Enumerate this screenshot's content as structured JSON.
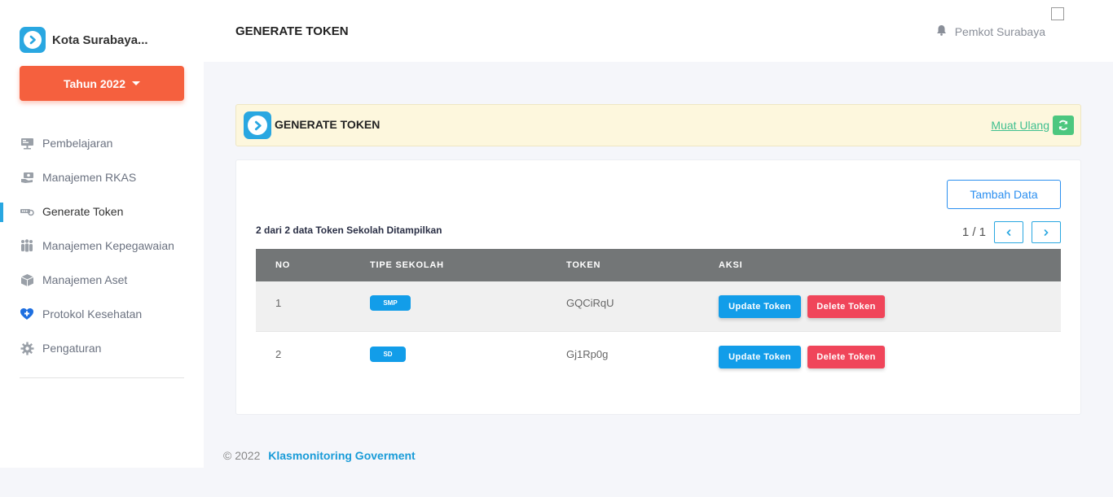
{
  "sidebar": {
    "brand_name": "Kota Surabaya...",
    "year_button": "Tahun 2022",
    "items": [
      {
        "label": "Pembelajaran",
        "icon": "presentation-board-icon"
      },
      {
        "label": "Manajemen RKAS",
        "icon": "money-hand-icon"
      },
      {
        "label": "Generate Token",
        "icon": "token-key-icon",
        "active": true
      },
      {
        "label": "Manajemen Kepegawaian",
        "icon": "people-group-icon"
      },
      {
        "label": "Manajemen Aset",
        "icon": "box-icon"
      },
      {
        "label": "Protokol Kesehatan",
        "icon": "heart-plus-icon"
      },
      {
        "label": "Pengaturan",
        "icon": "gear-icon"
      }
    ]
  },
  "topbar": {
    "title": "GENERATE TOKEN",
    "user_name": "Pemkot Surabaya"
  },
  "header_card": {
    "title": "GENERATE TOKEN",
    "reload_label": "Muat Ulang"
  },
  "content": {
    "add_button": "Tambah Data",
    "summary": "2 dari 2 data Token Sekolah Ditampilkan",
    "page_info": "1 / 1",
    "table": {
      "headers": [
        "NO",
        "TIPE SEKOLAH",
        "TOKEN",
        "AKSI"
      ],
      "rows": [
        {
          "no": "1",
          "tipe": "SMP",
          "token": "GQCiRqU",
          "update": "Update Token",
          "delete": "Delete Token"
        },
        {
          "no": "2",
          "tipe": "SD",
          "token": "Gj1Rp0g",
          "update": "Update Token",
          "delete": "Delete Token"
        }
      ]
    }
  },
  "footer": {
    "copyright": "© 2022",
    "brand": "Klasmonitoring Goverment"
  },
  "colors": {
    "accent_blue": "#29a7e1",
    "year_button": "#f5603e",
    "header_card_bg": "#fdf7dd",
    "reload_green": "#4cc77f",
    "delete_red": "#f0455a",
    "table_header": "#737677"
  }
}
